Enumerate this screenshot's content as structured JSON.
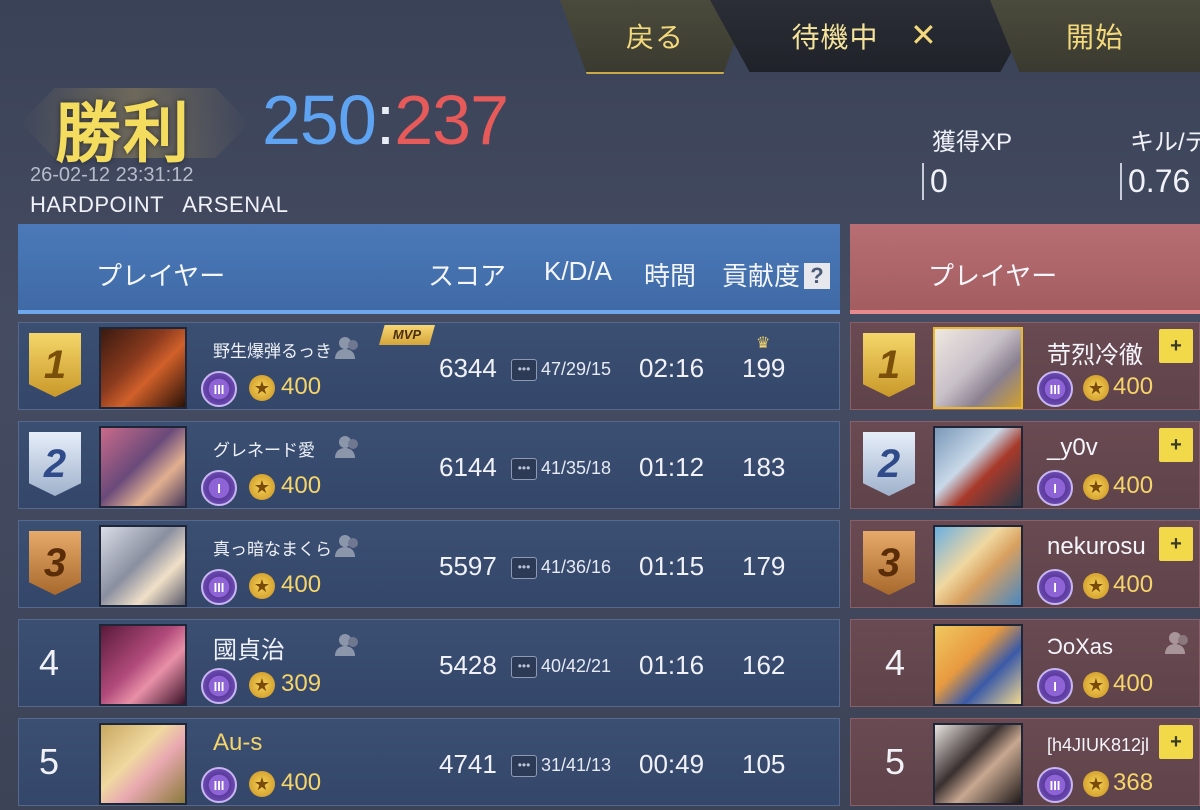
{
  "topbar": {
    "back": "戻る",
    "waiting": "待機中",
    "close": "✕",
    "start": "開始"
  },
  "result": {
    "title": "勝利",
    "blue_score": "250",
    "sep": ":",
    "red_score": "237",
    "datetime": "26-02-12 23:31:12",
    "mode": "HARDPOINT   ARSENAL"
  },
  "stats": [
    {
      "label": "獲得XP",
      "value": "0"
    },
    {
      "label": "キル/デ",
      "value": "0.76"
    }
  ],
  "headers": {
    "player": "プレイヤー",
    "score": "スコア",
    "kda": "K/D/A",
    "time": "時間",
    "contribution": "貢献度",
    "help": "?",
    "enemy_player": "プレイヤー"
  },
  "mvp_label": "MVP",
  "blue_team": [
    {
      "rank": "1",
      "name": "野生爆弾るっき",
      "level": "III",
      "points": "400",
      "score": "6344",
      "kda": "47/29/15",
      "time": "02:16",
      "contribution": "199"
    },
    {
      "rank": "2",
      "name": "グレネード愛",
      "level": "I",
      "points": "400",
      "score": "6144",
      "kda": "41/35/18",
      "time": "01:12",
      "contribution": "183"
    },
    {
      "rank": "3",
      "name": "真っ暗なまくら",
      "level": "III",
      "points": "400",
      "score": "5597",
      "kda": "41/36/16",
      "time": "01:15",
      "contribution": "179"
    },
    {
      "rank": "4",
      "name": "國貞治",
      "level": "III",
      "points": "309",
      "score": "5428",
      "kda": "40/42/21",
      "time": "01:16",
      "contribution": "162"
    },
    {
      "rank": "5",
      "name": "Au-s",
      "level": "III",
      "points": "400",
      "score": "4741",
      "kda": "31/41/13",
      "time": "00:49",
      "contribution": "105"
    }
  ],
  "red_team": [
    {
      "rank": "1",
      "name": "苛烈冷徹",
      "level": "III",
      "points": "400"
    },
    {
      "rank": "2",
      "name": "_y0v",
      "level": "I",
      "points": "400"
    },
    {
      "rank": "3",
      "name": "nekurosu",
      "level": "I",
      "points": "400"
    },
    {
      "rank": "4",
      "name": "ƆoXas",
      "level": "I",
      "points": "400"
    },
    {
      "rank": "5",
      "name": "[h4JIUK812jl",
      "level": "III",
      "points": "368"
    }
  ],
  "colors": {
    "blue": "#5ea4f2",
    "red": "#e65a5a",
    "victory": "#f3dc5e",
    "gold": "#f5d46a"
  }
}
